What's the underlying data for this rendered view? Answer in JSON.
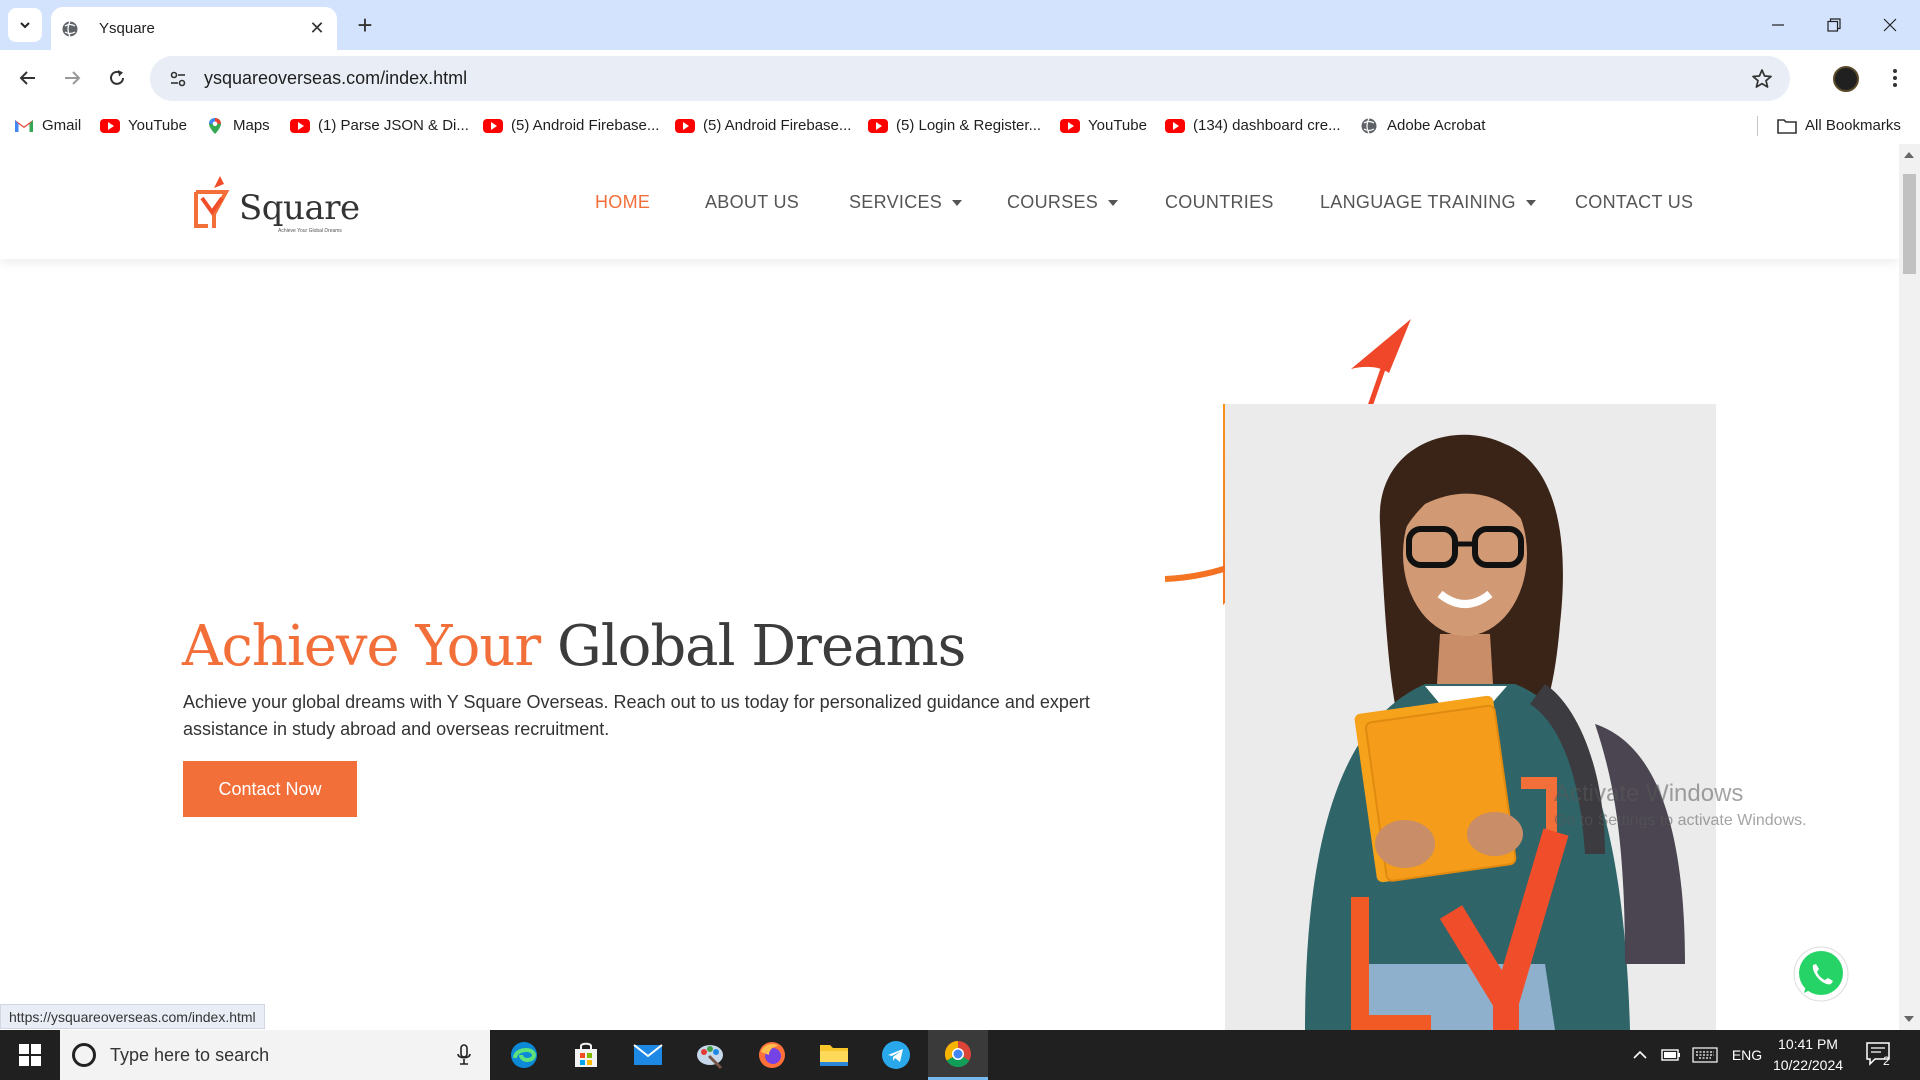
{
  "browser": {
    "tab_title": "Ysquare",
    "url": "ysquareoverseas.com/index.html",
    "status_url": "https://ysquareoverseas.com/index.html"
  },
  "bookmarks": [
    {
      "label": "Gmail",
      "icon": "gmail-icon"
    },
    {
      "label": "YouTube",
      "icon": "youtube-icon"
    },
    {
      "label": "Maps",
      "icon": "maps-icon"
    },
    {
      "label": "(1) Parse JSON & Di...",
      "icon": "youtube-icon"
    },
    {
      "label": "(5) Android Firebase...",
      "icon": "youtube-icon"
    },
    {
      "label": "(5) Android Firebase...",
      "icon": "youtube-icon"
    },
    {
      "label": "(5) Login & Register...",
      "icon": "youtube-icon"
    },
    {
      "label": "YouTube",
      "icon": "youtube-icon"
    },
    {
      "label": "(134) dashboard cre...",
      "icon": "youtube-icon"
    },
    {
      "label": "Adobe Acrobat",
      "icon": "globe-icon"
    }
  ],
  "all_bookmarks": "All Bookmarks",
  "site": {
    "logo_text": "Square",
    "logo_tagline": "Achieve Your Global Dreams",
    "nav": [
      {
        "label": "HOME",
        "active": true
      },
      {
        "label": "ABOUT US"
      },
      {
        "label": "SERVICES",
        "dropdown": true
      },
      {
        "label": "COURSES",
        "dropdown": true
      },
      {
        "label": "COUNTRIES"
      },
      {
        "label": "LANGUAGE TRAINING",
        "dropdown": true
      },
      {
        "label": "CONTACT US"
      }
    ],
    "hero": {
      "title_accent": "Achieve Your",
      "title_rest": "Global Dreams",
      "text": "Achieve your global dreams with Y Square Overseas. Reach out to us today for personalized guidance and expert assistance in study abroad and overseas recruitment.",
      "button": "Contact Now"
    },
    "accent_color": "#f36f3a"
  },
  "watermark": {
    "line1": "Activate Windows",
    "line2": "Go to Settings to activate Windows."
  },
  "taskbar": {
    "search_placeholder": "Type here to search",
    "apps": [
      "edge-icon",
      "store-icon",
      "mail-icon",
      "paint-icon",
      "firefox-icon",
      "file-explorer-icon",
      "telegram-icon",
      "chrome-icon"
    ],
    "language": "ENG",
    "time": "10:41 PM",
    "date": "10/22/2024",
    "notifications": "2"
  }
}
